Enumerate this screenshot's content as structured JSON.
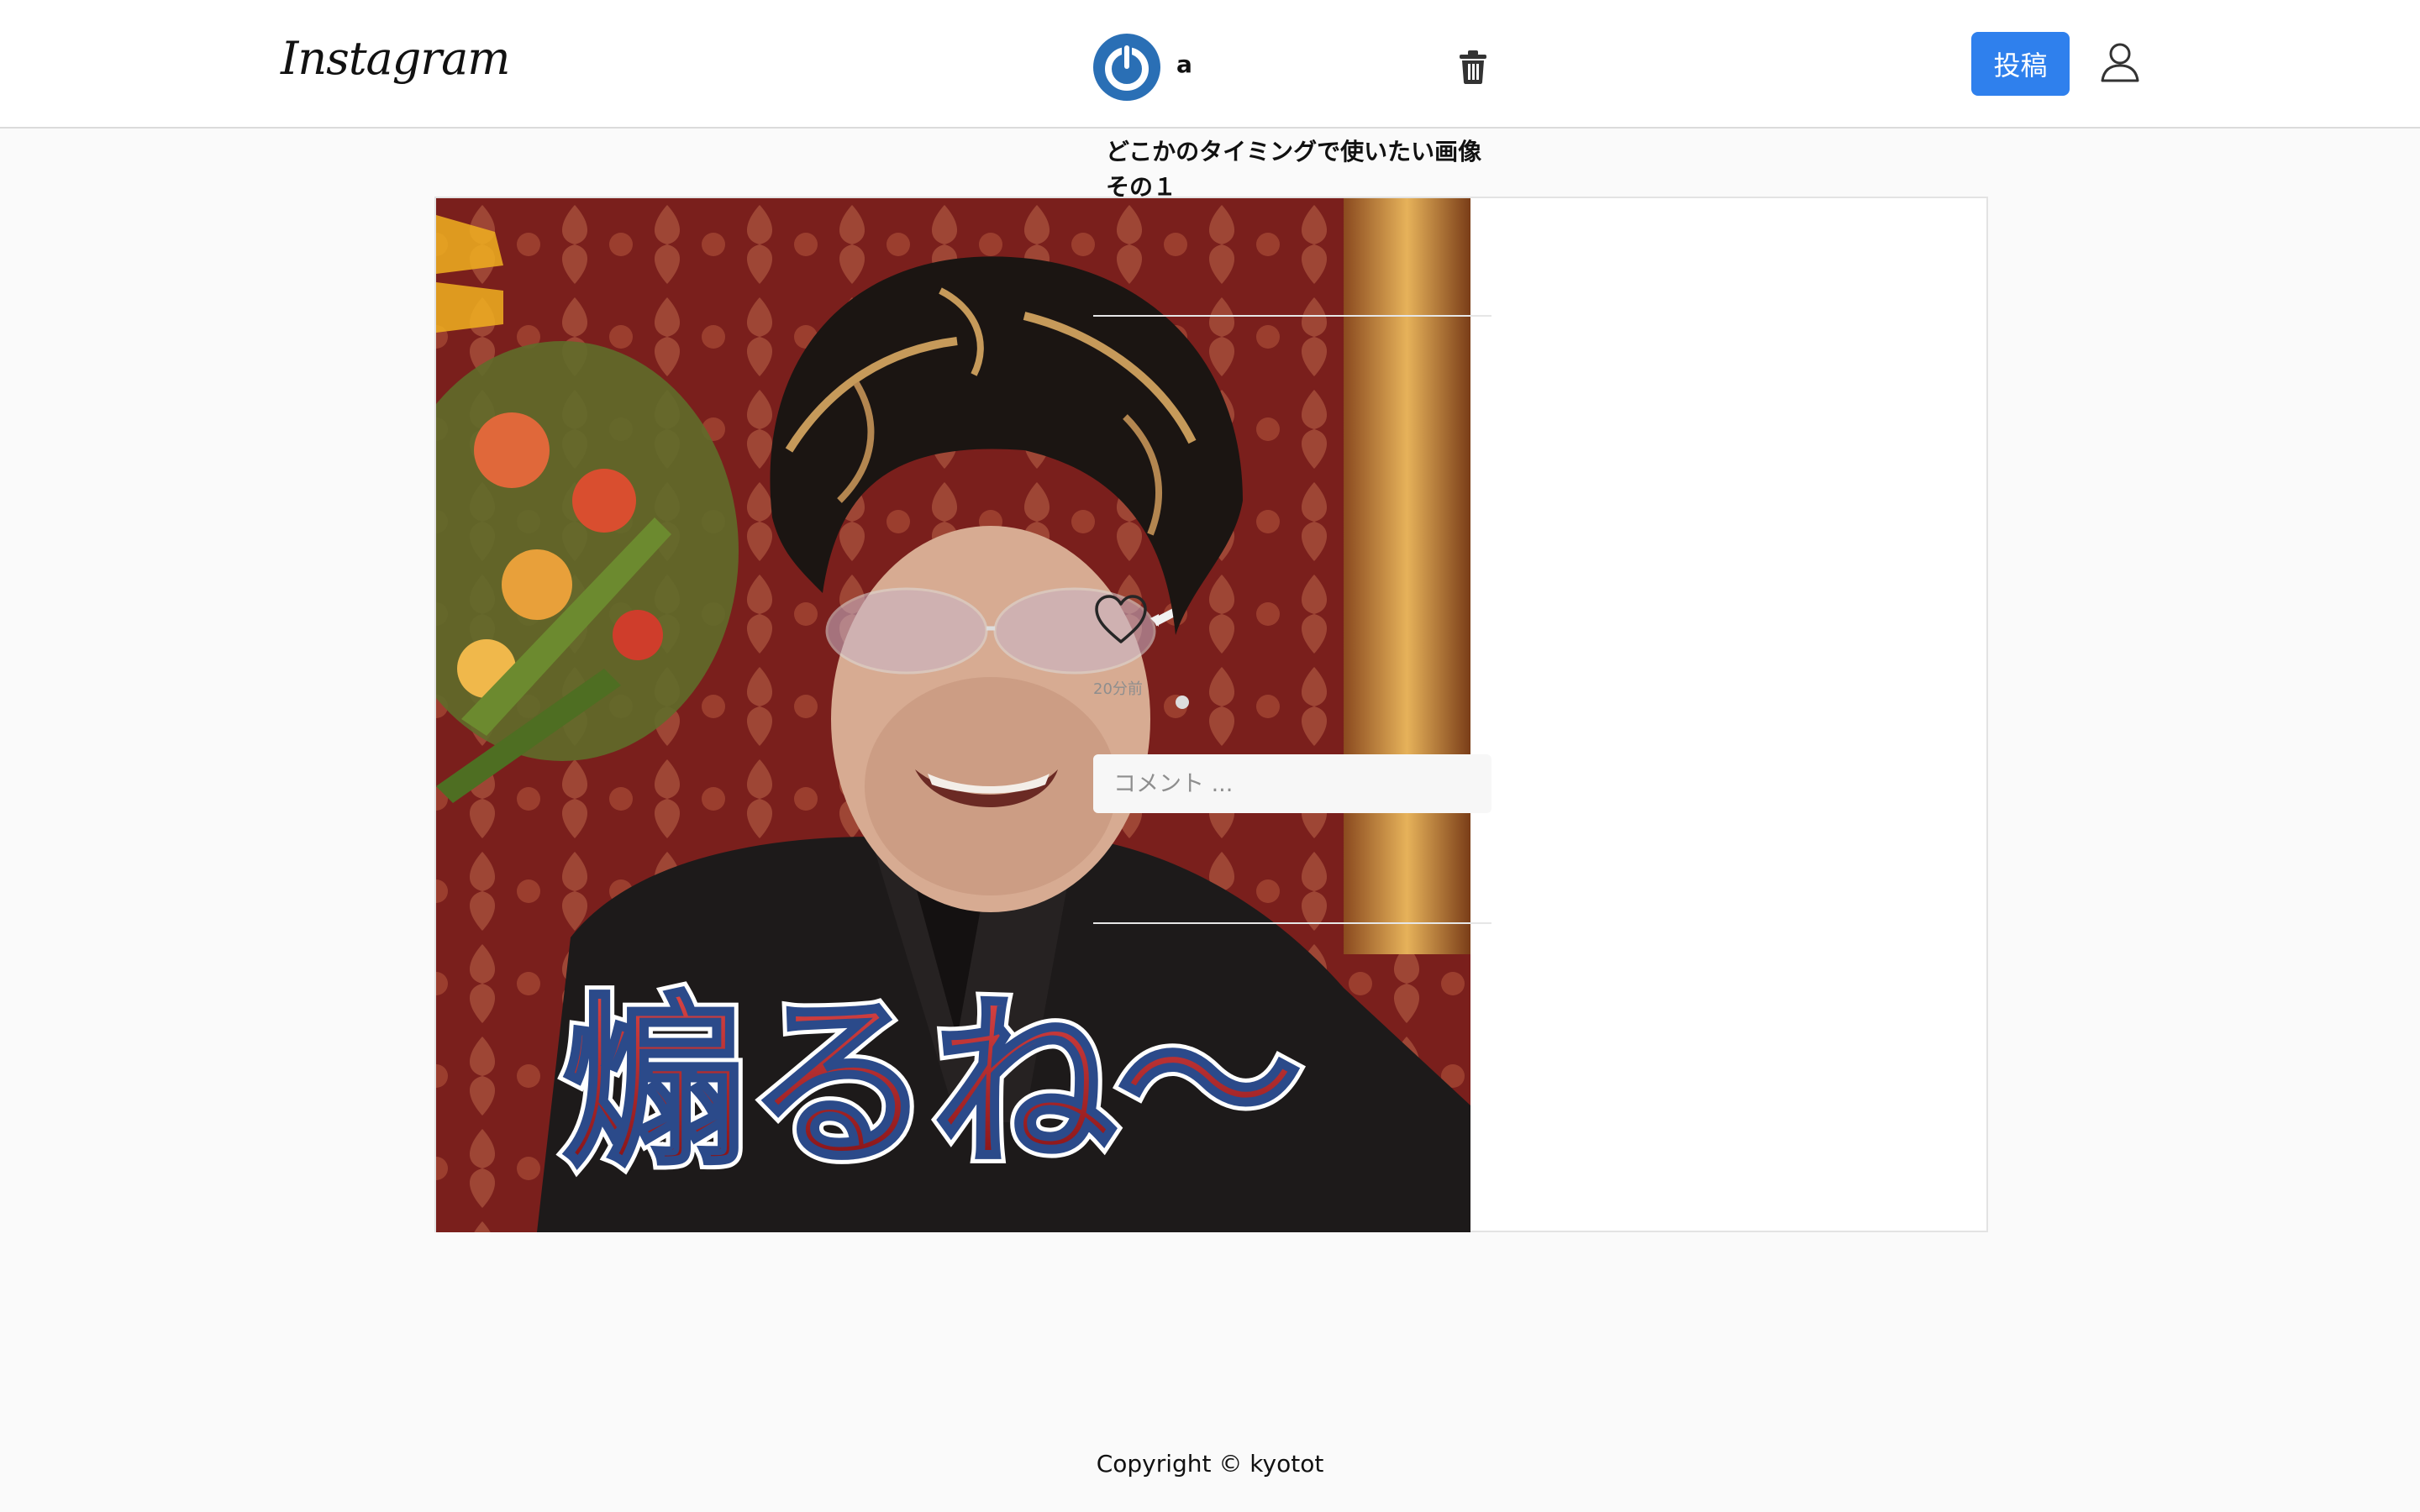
{
  "header": {
    "logo_text": "Instagram",
    "post_button_label": "投稿",
    "user_icon": "user-icon",
    "accent_color": "#2f80ed"
  },
  "post": {
    "username": "a",
    "avatar_icon": "avatar-power-icon",
    "delete_icon": "trash-icon",
    "caption": "どこかのタイミングで使いたい画像その１",
    "image_subtitle_text": "煽るね～",
    "like_icon": "heart-outline-icon",
    "timestamp": "20分前",
    "comment_placeholder": "コメント ..."
  },
  "footer": {
    "copyright": "Copyright © kyotot"
  }
}
